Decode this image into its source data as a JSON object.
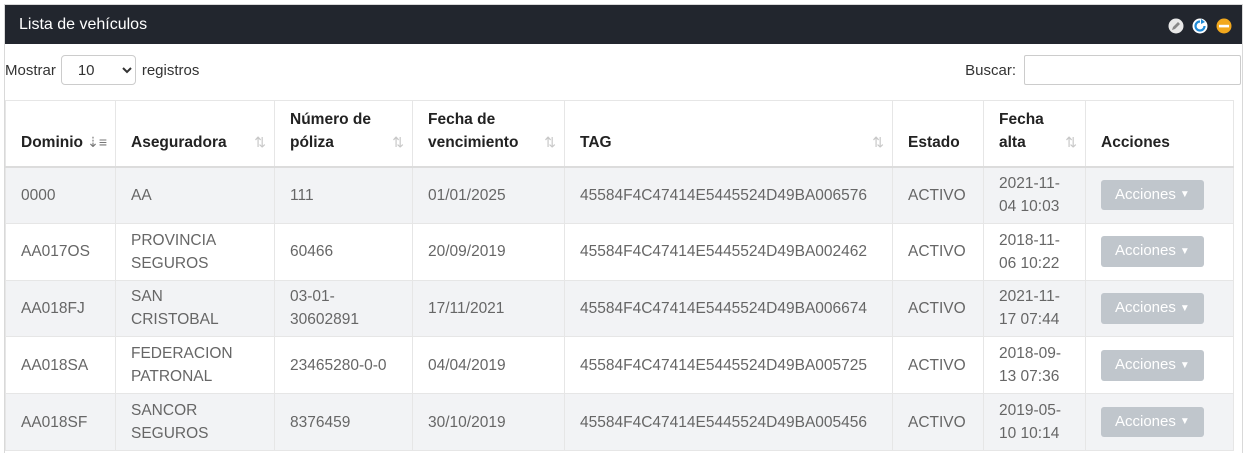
{
  "panel": {
    "title": "Lista de vehículos"
  },
  "controls": {
    "show_label": "Mostrar",
    "page_size": "10",
    "records_label": "registros",
    "search_label": "Buscar:",
    "search_value": ""
  },
  "columns": {
    "dominio": "Dominio",
    "aseguradora": "Aseguradora",
    "poliza_1": "Número de",
    "poliza_2": "póliza",
    "venc_1": "Fecha de",
    "venc_2": "vencimiento",
    "tag": "TAG",
    "estado": "Estado",
    "alta_1": "Fecha",
    "alta_2": "alta",
    "acciones": "Acciones"
  },
  "rows": [
    {
      "dominio": "0000",
      "aseg_1": "AA",
      "aseg_2": "",
      "poliza_1": "111",
      "poliza_2": "",
      "vencimiento": "01/01/2025",
      "tag": "45584F4C47414E5445524D49BA006576",
      "estado": "ACTIVO",
      "alta_1": "2021-11-",
      "alta_2": "04 10:03",
      "accion": "Acciones"
    },
    {
      "dominio": "AA017OS",
      "aseg_1": "PROVINCIA",
      "aseg_2": "SEGUROS",
      "poliza_1": "60466",
      "poliza_2": "",
      "vencimiento": "20/09/2019",
      "tag": "45584F4C47414E5445524D49BA002462",
      "estado": "ACTIVO",
      "alta_1": "2018-11-",
      "alta_2": "06 10:22",
      "accion": "Acciones"
    },
    {
      "dominio": "AA018FJ",
      "aseg_1": "SAN",
      "aseg_2": "CRISTOBAL",
      "poliza_1": "03-01-",
      "poliza_2": "30602891",
      "vencimiento": "17/11/2021",
      "tag": "45584F4C47414E5445524D49BA006674",
      "estado": "ACTIVO",
      "alta_1": "2021-11-",
      "alta_2": "17 07:44",
      "accion": "Acciones"
    },
    {
      "dominio": "AA018SA",
      "aseg_1": "FEDERACION",
      "aseg_2": "PATRONAL",
      "poliza_1": "23465280-0-0",
      "poliza_2": "",
      "vencimiento": "04/04/2019",
      "tag": "45584F4C47414E5445524D49BA005725",
      "estado": "ACTIVO",
      "alta_1": "2018-09-",
      "alta_2": "13 07:36",
      "accion": "Acciones"
    },
    {
      "dominio": "AA018SF",
      "aseg_1": "SANCOR",
      "aseg_2": "SEGUROS",
      "poliza_1": "8376459",
      "poliza_2": "",
      "vencimiento": "30/10/2019",
      "tag": "45584F4C47414E5445524D49BA005456",
      "estado": "ACTIVO",
      "alta_1": "2019-05-",
      "alta_2": "10 10:14",
      "accion": "Acciones"
    }
  ],
  "icons": {
    "tool_1": "edit-icon",
    "tool_2": "refresh-icon",
    "tool_3": "collapse-icon",
    "sort_active": "sort-amount-down-icon",
    "sort": "sort-icon"
  },
  "colors": {
    "header_bg": "#22262e",
    "row_alt_bg": "#f2f3f5",
    "button_bg": "#c0c6cc",
    "refresh": "#1e8ad6",
    "collapse": "#f2a81d"
  }
}
